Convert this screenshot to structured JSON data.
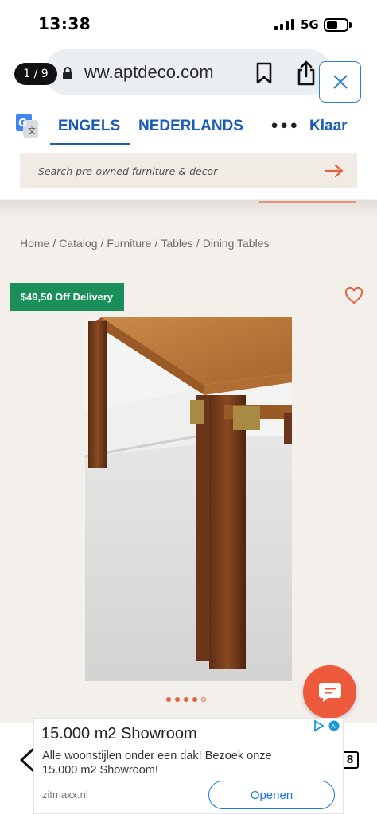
{
  "status": {
    "time": "13:38",
    "network": "5G"
  },
  "browser": {
    "counter": "1 / 9",
    "url": "ww.aptdeco.com"
  },
  "translate": {
    "lang_from": "ENGELS",
    "lang_to": "NEDERLANDS",
    "more": "•••",
    "done": "Klaar"
  },
  "search": {
    "placeholder": "Search pre-owned furniture & decor"
  },
  "breadcrumb": [
    "Home",
    "/",
    "Catalog",
    "/",
    "Furniture",
    "/",
    "Tables",
    "/",
    "Dining Tables"
  ],
  "product": {
    "badge": "$49,50 Off Delivery",
    "image_count": 5,
    "active_image": 4
  },
  "nav": {
    "tabs_count": "8"
  },
  "ad": {
    "title": "15.000 m2 Showroom",
    "body": "Alle woonstijlen onder een dak! Bezoek onze 15.000 m2 Showroom!",
    "source": "zitmaxx.nl",
    "cta": "Openen"
  },
  "colors": {
    "accent": "#e5603e",
    "badge": "#1a8f5a",
    "link": "#1a5bb5"
  }
}
